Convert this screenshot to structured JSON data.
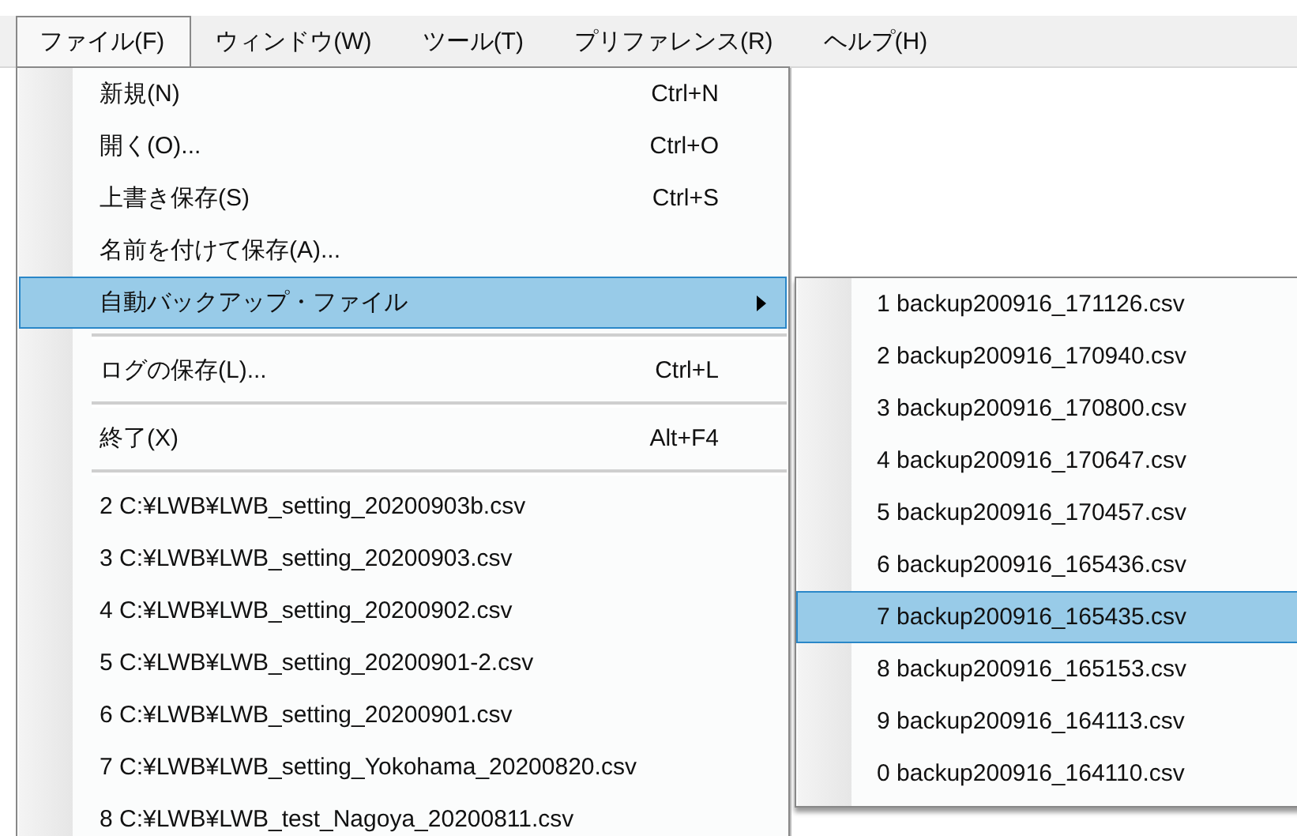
{
  "menubar": [
    {
      "label": "ファイル(F)",
      "selected": true
    },
    {
      "label": "ウィンドウ(W)",
      "selected": false
    },
    {
      "label": "ツール(T)",
      "selected": false
    },
    {
      "label": "プリファレンス(R)",
      "selected": false
    },
    {
      "label": "ヘルプ(H)",
      "selected": false
    }
  ],
  "file_menu": {
    "items": [
      {
        "kind": "item",
        "label": "新規(N)",
        "shortcut": "Ctrl+N",
        "selected": false
      },
      {
        "kind": "item",
        "label": "開く(O)...",
        "shortcut": "Ctrl+O",
        "selected": false
      },
      {
        "kind": "item",
        "label": "上書き保存(S)",
        "shortcut": "Ctrl+S",
        "selected": false
      },
      {
        "kind": "item",
        "label": "名前を付けて保存(A)...",
        "selected": false
      },
      {
        "kind": "submenu",
        "label": "自動バックアップ・ファイル",
        "selected": true
      },
      {
        "kind": "separator"
      },
      {
        "kind": "item",
        "label": "ログの保存(L)...",
        "shortcut": "Ctrl+L",
        "selected": false
      },
      {
        "kind": "separator"
      },
      {
        "kind": "item",
        "label": "終了(X)",
        "shortcut": "Alt+F4",
        "selected": false
      },
      {
        "kind": "separator"
      },
      {
        "kind": "item",
        "label": "2 C:¥LWB¥LWB_setting_20200903b.csv",
        "selected": false
      },
      {
        "kind": "item",
        "label": "3 C:¥LWB¥LWB_setting_20200903.csv",
        "selected": false
      },
      {
        "kind": "item",
        "label": "4 C:¥LWB¥LWB_setting_20200902.csv",
        "selected": false
      },
      {
        "kind": "item",
        "label": "5 C:¥LWB¥LWB_setting_20200901-2.csv",
        "selected": false
      },
      {
        "kind": "item",
        "label": "6 C:¥LWB¥LWB_setting_20200901.csv",
        "selected": false
      },
      {
        "kind": "item",
        "label": "7 C:¥LWB¥LWB_setting_Yokohama_20200820.csv",
        "selected": false
      },
      {
        "kind": "item",
        "label": "8 C:¥LWB¥LWB_test_Nagoya_20200811.csv",
        "selected": false
      }
    ]
  },
  "backup_submenu": {
    "items": [
      {
        "label": "1 backup200916_171126.csv",
        "selected": false
      },
      {
        "label": "2 backup200916_170940.csv",
        "selected": false
      },
      {
        "label": "3 backup200916_170800.csv",
        "selected": false
      },
      {
        "label": "4 backup200916_170647.csv",
        "selected": false
      },
      {
        "label": "5 backup200916_170457.csv",
        "selected": false
      },
      {
        "label": "6 backup200916_165436.csv",
        "selected": false
      },
      {
        "label": "7 backup200916_165435.csv",
        "selected": true
      },
      {
        "label": "8 backup200916_165153.csv",
        "selected": false
      },
      {
        "label": "9 backup200916_164113.csv",
        "selected": false
      },
      {
        "label": "0 backup200916_164110.csv",
        "selected": false
      }
    ]
  }
}
